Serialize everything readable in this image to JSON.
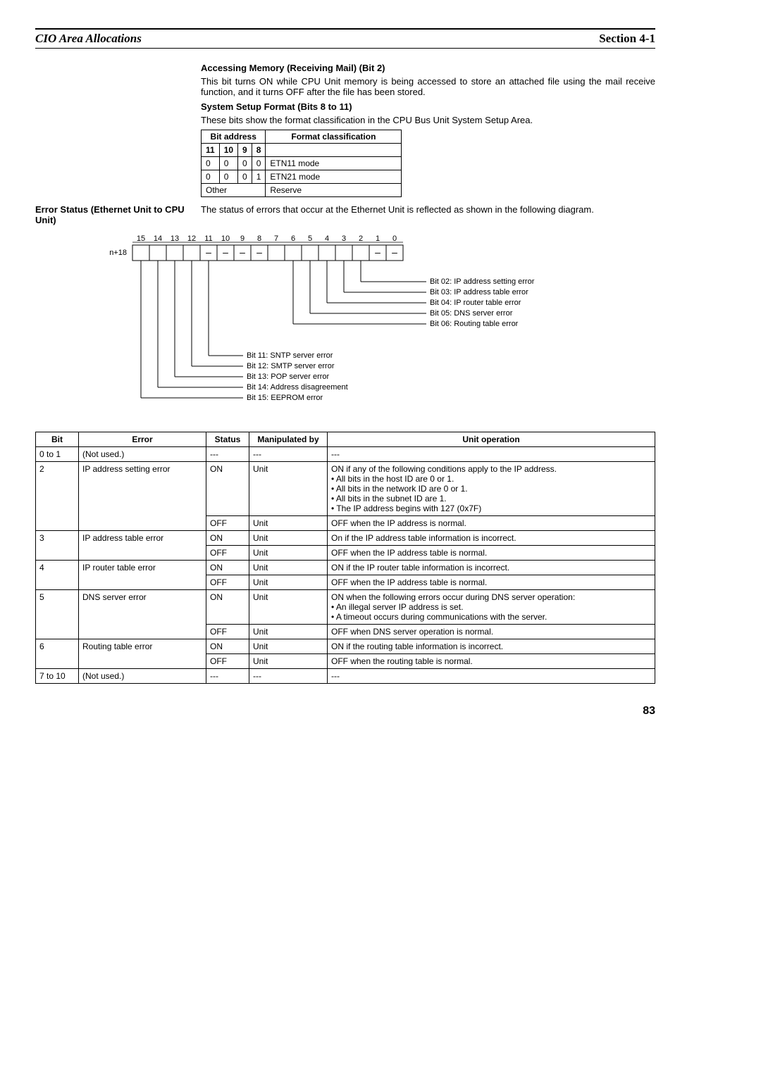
{
  "header": {
    "left": "CIO Area Allocations",
    "right": "Section 4-1"
  },
  "sec1": {
    "heading": "Accessing Memory (Receiving Mail) (Bit 2)",
    "body": "This bit turns ON while CPU Unit memory is being accessed to store an attached file using the mail receive function, and it turns OFF after the file has been stored."
  },
  "sec2": {
    "heading": "System Setup Format (Bits 8 to 11)",
    "body": "These bits show the format classification in the CPU Bus Unit System Setup Area."
  },
  "bit_table": {
    "head_bit": "Bit address",
    "head_format": "Format classification",
    "cols": [
      "11",
      "10",
      "9",
      "8"
    ],
    "rows": [
      {
        "c": [
          "0",
          "0",
          "0",
          "0"
        ],
        "f": "ETN11 mode"
      },
      {
        "c": [
          "0",
          "0",
          "0",
          "1"
        ],
        "f": "ETN21 mode"
      }
    ],
    "other": "Other",
    "reserve": "Reserve"
  },
  "side": {
    "label": "Error Status (Ethernet Unit to CPU Unit)",
    "body": "The status of errors that occur at the Ethernet Unit is reflected as shown in the following diagram."
  },
  "diagram": {
    "rowlabel": "n+18",
    "bits": [
      "15",
      "14",
      "13",
      "12",
      "11",
      "10",
      "9",
      "8",
      "7",
      "6",
      "5",
      "4",
      "3",
      "2",
      "1",
      "0"
    ],
    "right_labels": [
      "Bit 02: IP address setting error",
      "Bit 03: IP address table error",
      "Bit 04: IP router table error",
      "Bit 05: DNS server error",
      "Bit 06: Routing table error"
    ],
    "bottom_labels": [
      "Bit 11: SNTP server error",
      "Bit 12: SMTP server error",
      "Bit 13: POP server error",
      "Bit 14: Address disagreement",
      "Bit 15: EEPROM error"
    ]
  },
  "err_table": {
    "headers": [
      "Bit",
      "Error",
      "Status",
      "Manipulated by",
      "Unit operation"
    ],
    "r0": {
      "bit": "0 to 1",
      "error": "(Not used.)",
      "status": "---",
      "manip": "---",
      "op": "---"
    },
    "r1": {
      "bit": "2",
      "error": "IP address setting error",
      "status": "ON",
      "manip": "Unit",
      "ops": [
        "ON if any of the following conditions apply to the IP address.",
        "• All bits in the host ID are 0 or 1.",
        "• All bits in the network ID are 0 or 1.",
        "• All bits in the subnet ID are 1.",
        "• The IP address begins with 127 (0x7F)"
      ]
    },
    "r1b": {
      "status": "OFF",
      "manip": "Unit",
      "op": "OFF when the IP address is normal."
    },
    "r2": {
      "bit": "3",
      "error": "IP address table error",
      "status": "ON",
      "manip": "Unit",
      "op": "On if the IP address table information is incorrect."
    },
    "r2b": {
      "status": "OFF",
      "manip": "Unit",
      "op": "OFF when the IP address table is normal."
    },
    "r3": {
      "bit": "4",
      "error": "IP router table error",
      "status": "ON",
      "manip": "Unit",
      "op": "ON if the IP router table information is incorrect."
    },
    "r3b": {
      "status": "OFF",
      "manip": "Unit",
      "op": "OFF when the IP address table is normal."
    },
    "r4": {
      "bit": "5",
      "error": "DNS server error",
      "status": "ON",
      "manip": "Unit",
      "ops": [
        "ON when the following errors occur during DNS server operation:",
        "• An illegal server IP address is set.",
        "• A timeout occurs during communications with the server."
      ]
    },
    "r4b": {
      "status": "OFF",
      "manip": "Unit",
      "op": "OFF when DNS server operation is normal."
    },
    "r5": {
      "bit": "6",
      "error": "Routing table error",
      "status": "ON",
      "manip": "Unit",
      "op": "ON if the routing table information is incorrect."
    },
    "r5b": {
      "status": "OFF",
      "manip": "Unit",
      "op": "OFF when the routing table is normal."
    },
    "r6": {
      "bit": "7 to 10",
      "error": "(Not used.)",
      "status": "---",
      "manip": "---",
      "op": "---"
    }
  },
  "page_number": "83"
}
